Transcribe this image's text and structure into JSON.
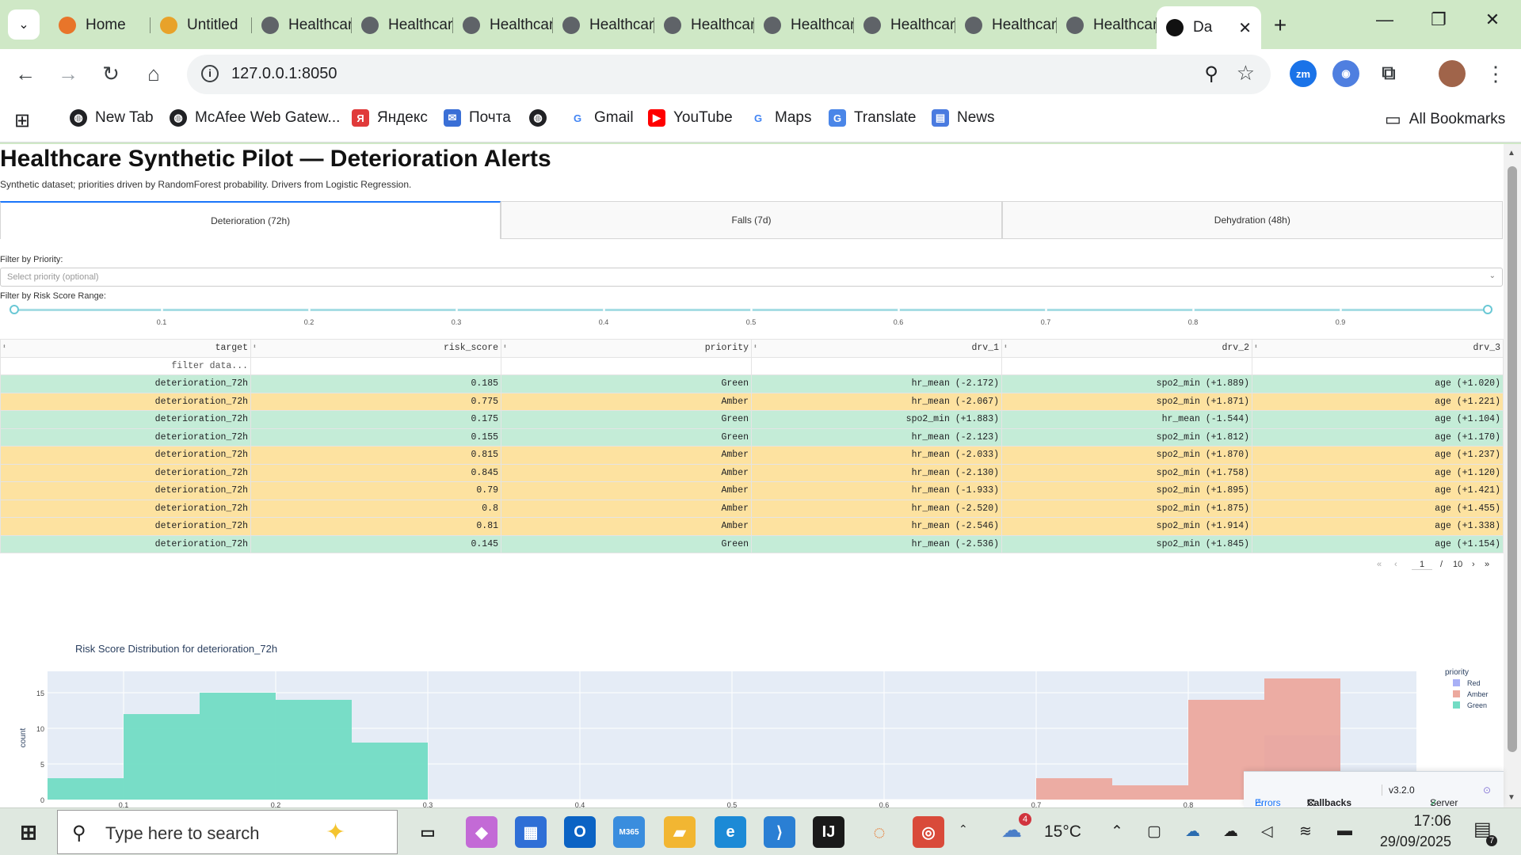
{
  "browser": {
    "tabs": [
      {
        "title": "Home",
        "icon": "ring-icon"
      },
      {
        "title": "Untitled",
        "icon": "notebook-icon"
      },
      {
        "title": "Healthcare",
        "icon": "globe-icon"
      },
      {
        "title": "Healthcare",
        "icon": "globe-icon"
      },
      {
        "title": "Healthcare",
        "icon": "globe-icon"
      },
      {
        "title": "Healthcare",
        "icon": "globe-icon"
      },
      {
        "title": "Healthcare",
        "icon": "globe-icon"
      },
      {
        "title": "Healthcare",
        "icon": "globe-icon"
      },
      {
        "title": "Healthcare",
        "icon": "globe-icon"
      },
      {
        "title": "Healthcare",
        "icon": "globe-icon"
      },
      {
        "title": "Healthcare",
        "icon": "globe-icon"
      },
      {
        "title": "Da",
        "icon": "dash-icon",
        "active": true
      }
    ],
    "url": "127.0.0.1:8050",
    "bookmarks": [
      {
        "label": "New Tab",
        "icon": "globe-icon"
      },
      {
        "label": "McAfee Web Gatew...",
        "icon": "globe-icon"
      },
      {
        "label": "Яндекс",
        "icon": "yandex-icon"
      },
      {
        "label": "Почта",
        "icon": "mail-icon"
      },
      {
        "label": "",
        "icon": "globe-icon"
      },
      {
        "label": "Gmail",
        "icon": "google-icon"
      },
      {
        "label": "YouTube",
        "icon": "youtube-icon"
      },
      {
        "label": "Maps",
        "icon": "google-icon"
      },
      {
        "label": "Translate",
        "icon": "translate-icon"
      },
      {
        "label": "News",
        "icon": "news-icon"
      }
    ],
    "all_bookmarks": "All Bookmarks",
    "extension_zm": "zm"
  },
  "app": {
    "title": "Healthcare Synthetic Pilot — Deterioration Alerts",
    "subtitle": "Synthetic dataset; priorities driven by RandomForest probability. Drivers from Logistic Regression.",
    "tabs": [
      "Deterioration (72h)",
      "Falls (7d)",
      "Dehydration (48h)"
    ],
    "filter_priority_label": "Filter by Priority:",
    "filter_priority_placeholder": "Select priority (optional)",
    "filter_risk_label": "Filter by Risk Score Range:",
    "slider": {
      "min": 0,
      "max": 1,
      "value": [
        0,
        1
      ],
      "ticks": [
        "0.1",
        "0.2",
        "0.3",
        "0.4",
        "0.5",
        "0.6",
        "0.7",
        "0.8",
        "0.9"
      ]
    },
    "table": {
      "columns": [
        "target",
        "risk_score",
        "priority",
        "drv_1",
        "drv_2",
        "drv_3"
      ],
      "filter_placeholder": "filter data...",
      "rows": [
        {
          "target": "deterioration_72h",
          "risk_score": "0.185",
          "priority": "Green",
          "drv_1": "hr_mean (-2.172)",
          "drv_2": "spo2_min (+1.889)",
          "drv_3": "age (+1.020)"
        },
        {
          "target": "deterioration_72h",
          "risk_score": "0.775",
          "priority": "Amber",
          "drv_1": "hr_mean (-2.067)",
          "drv_2": "spo2_min (+1.871)",
          "drv_3": "age (+1.221)"
        },
        {
          "target": "deterioration_72h",
          "risk_score": "0.175",
          "priority": "Green",
          "drv_1": "spo2_min (+1.883)",
          "drv_2": "hr_mean (-1.544)",
          "drv_3": "age (+1.104)"
        },
        {
          "target": "deterioration_72h",
          "risk_score": "0.155",
          "priority": "Green",
          "drv_1": "hr_mean (-2.123)",
          "drv_2": "spo2_min (+1.812)",
          "drv_3": "age (+1.170)"
        },
        {
          "target": "deterioration_72h",
          "risk_score": "0.815",
          "priority": "Amber",
          "drv_1": "hr_mean (-2.033)",
          "drv_2": "spo2_min (+1.870)",
          "drv_3": "age (+1.237)"
        },
        {
          "target": "deterioration_72h",
          "risk_score": "0.845",
          "priority": "Amber",
          "drv_1": "hr_mean (-2.130)",
          "drv_2": "spo2_min (+1.758)",
          "drv_3": "age (+1.120)"
        },
        {
          "target": "deterioration_72h",
          "risk_score": "0.79",
          "priority": "Amber",
          "drv_1": "hr_mean (-1.933)",
          "drv_2": "spo2_min (+1.895)",
          "drv_3": "age (+1.421)"
        },
        {
          "target": "deterioration_72h",
          "risk_score": "0.8",
          "priority": "Amber",
          "drv_1": "hr_mean (-2.520)",
          "drv_2": "spo2_min (+1.875)",
          "drv_3": "age (+1.455)"
        },
        {
          "target": "deterioration_72h",
          "risk_score": "0.81",
          "priority": "Amber",
          "drv_1": "hr_mean (-2.546)",
          "drv_2": "spo2_min (+1.914)",
          "drv_3": "age (+1.338)"
        },
        {
          "target": "deterioration_72h",
          "risk_score": "0.145",
          "priority": "Green",
          "drv_1": "hr_mean (-2.536)",
          "drv_2": "spo2_min (+1.845)",
          "drv_3": "age (+1.154)"
        }
      ]
    },
    "pager": {
      "current": "1",
      "sep": "/",
      "total": "10"
    },
    "devtools": {
      "errors": "Errors",
      "callbacks": "Callbacks",
      "version": "v3.2.0",
      "server": "Server"
    }
  },
  "chart_data": {
    "type": "bar",
    "title": "Risk Score Distribution for deterioration_72h",
    "xlabel": "",
    "ylabel": "count",
    "x_ticks": [
      "0.1",
      "0.2",
      "0.3",
      "0.4",
      "0.5",
      "0.6",
      "0.7",
      "0.8"
    ],
    "y_ticks": [
      "0",
      "5",
      "10",
      "15"
    ],
    "xlim": [
      0.05,
      0.95
    ],
    "ylim": [
      0,
      18
    ],
    "bin_width": 0.05,
    "legend_title": "priority",
    "legend_position": "right",
    "series": [
      {
        "name": "Red",
        "color": "#a8b0f6",
        "bins": [
          {
            "x0": 0.85,
            "count": 9
          }
        ]
      },
      {
        "name": "Amber",
        "color": "#eca99e",
        "bins": [
          {
            "x0": 0.7,
            "count": 3
          },
          {
            "x0": 0.75,
            "count": 2
          },
          {
            "x0": 0.8,
            "count": 14
          },
          {
            "x0": 0.85,
            "count": 17
          }
        ]
      },
      {
        "name": "Green",
        "color": "#72dcc4",
        "bins": [
          {
            "x0": 0.05,
            "count": 3
          },
          {
            "x0": 0.1,
            "count": 12
          },
          {
            "x0": 0.15,
            "count": 15
          },
          {
            "x0": 0.2,
            "count": 14
          },
          {
            "x0": 0.25,
            "count": 8
          }
        ]
      }
    ]
  },
  "taskbar": {
    "search_placeholder": "Type here to search",
    "weather": "15°C",
    "weather_badge": "4",
    "time": "17:06",
    "date": "29/09/2025",
    "notifications": "7"
  }
}
